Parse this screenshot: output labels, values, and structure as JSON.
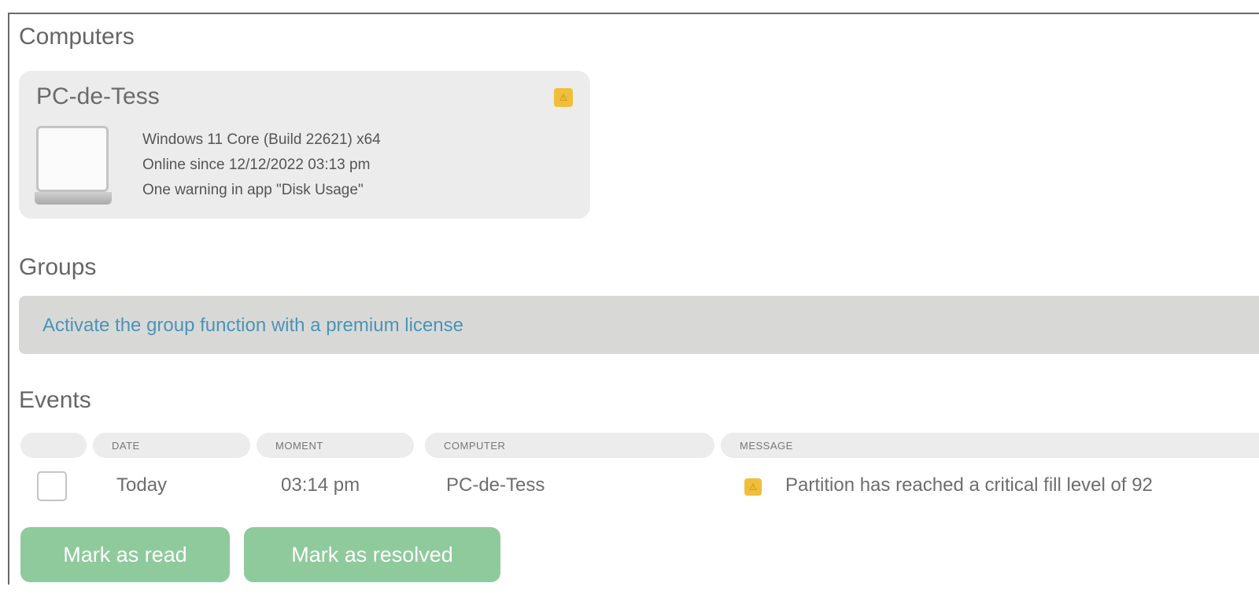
{
  "sections": {
    "computers": "Computers",
    "groups": "Groups",
    "events": "Events"
  },
  "computer_card": {
    "name": "PC-de-Tess",
    "os": "Windows 11 Core (Build 22621) x64",
    "online": "Online since 12/12/2022 03:13 pm",
    "warning": "One warning in app \"Disk Usage\"",
    "warning_icon": "warning-icon",
    "warning_color": "#efbf3c"
  },
  "groups": {
    "link_text": "Activate the group function with a premium license"
  },
  "events": {
    "columns": [
      "DATE",
      "MOMENT",
      "COMPUTER",
      "MESSAGE"
    ],
    "rows": [
      {
        "date": "Today",
        "moment": "03:14 pm",
        "computer": "PC-de-Tess",
        "message": "Partition has reached a critical fill level of 92"
      }
    ],
    "buttons": {
      "mark_read": "Mark as read",
      "mark_resolved": "Mark as resolved"
    },
    "button_color": "#8fca9c"
  }
}
